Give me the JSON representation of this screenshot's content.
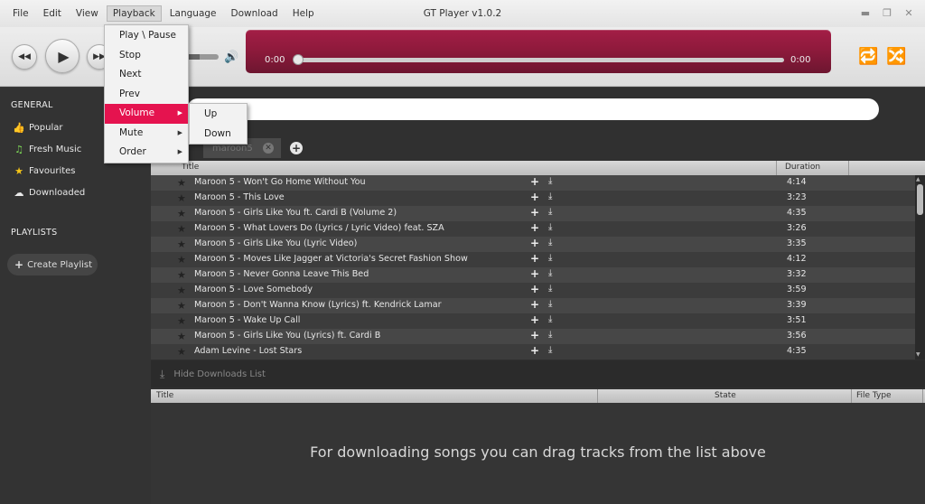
{
  "menubar": {
    "items": [
      "File",
      "Edit",
      "View",
      "Playback",
      "Language",
      "Download",
      "Help"
    ],
    "active_index": 3
  },
  "window": {
    "title": "GT Player v1.0.2"
  },
  "player": {
    "current_time": "0:00",
    "total_time": "0:00",
    "progress": 0,
    "volume": 0.5
  },
  "playback_menu": {
    "items": [
      {
        "label": "Play \\ Pause",
        "submenu": false
      },
      {
        "label": "Stop",
        "submenu": false
      },
      {
        "label": "Next",
        "submenu": false
      },
      {
        "label": "Prev",
        "submenu": false
      },
      {
        "label": "Volume",
        "submenu": true,
        "highlighted": true
      },
      {
        "label": "Mute",
        "submenu": true
      },
      {
        "label": "Order",
        "submenu": true
      }
    ]
  },
  "volume_submenu": {
    "items": [
      "Up",
      "Down"
    ]
  },
  "sidebar": {
    "general_heading": "GENERAL",
    "items": [
      {
        "label": "Popular",
        "icon": "thumbs-up-icon",
        "color": "#e8334a"
      },
      {
        "label": "Fresh Music",
        "icon": "music-note-icon",
        "color": "#7ed957"
      },
      {
        "label": "Favourites",
        "icon": "star-icon",
        "color": "#f5c518"
      },
      {
        "label": "Downloaded",
        "icon": "cloud-download-icon",
        "color": "#e8e8e8"
      }
    ],
    "playlists_heading": "PLAYLISTS",
    "create_playlist": "Create Playlist"
  },
  "search": {
    "value": ""
  },
  "tabs": [
    {
      "label": "maroon5"
    }
  ],
  "tracks_table": {
    "columns": [
      "Title",
      "Duration"
    ],
    "rows": [
      {
        "title": "Maroon 5 - Won't Go Home Without You",
        "duration": "4:14"
      },
      {
        "title": "Maroon 5 - This Love",
        "duration": "3:23"
      },
      {
        "title": "Maroon 5 - Girls Like You ft. Cardi B (Volume 2)",
        "duration": "4:35"
      },
      {
        "title": "Maroon 5 - What Lovers Do (Lyrics / Lyric Video) feat. SZA",
        "duration": "3:26"
      },
      {
        "title": "Maroon 5 - Girls Like You (Lyric Video)",
        "duration": "3:35"
      },
      {
        "title": "Maroon 5 - Moves Like Jagger at Victoria's Secret Fashion Show",
        "duration": "4:12"
      },
      {
        "title": "Maroon 5 - Never Gonna Leave This Bed",
        "duration": "3:32"
      },
      {
        "title": "Maroon 5 - Love Somebody",
        "duration": "3:59"
      },
      {
        "title": "Maroon 5 - Don't Wanna Know (Lyrics) ft. Kendrick Lamar",
        "duration": "3:39"
      },
      {
        "title": "Maroon 5 - Wake Up Call",
        "duration": "3:51"
      },
      {
        "title": "Maroon 5 - Girls Like You (Lyrics) ft. Cardi B",
        "duration": "3:56"
      },
      {
        "title": "Adam Levine - Lost Stars",
        "duration": "4:35"
      }
    ]
  },
  "downloads": {
    "toggle_label": "Hide Downloads List",
    "columns": [
      "Title",
      "State",
      "File Type"
    ],
    "empty_message": "For downloading songs you can drag tracks from the list above"
  },
  "colors": {
    "accent": "#e5134f",
    "seek_panel": "#8f1a3c"
  }
}
